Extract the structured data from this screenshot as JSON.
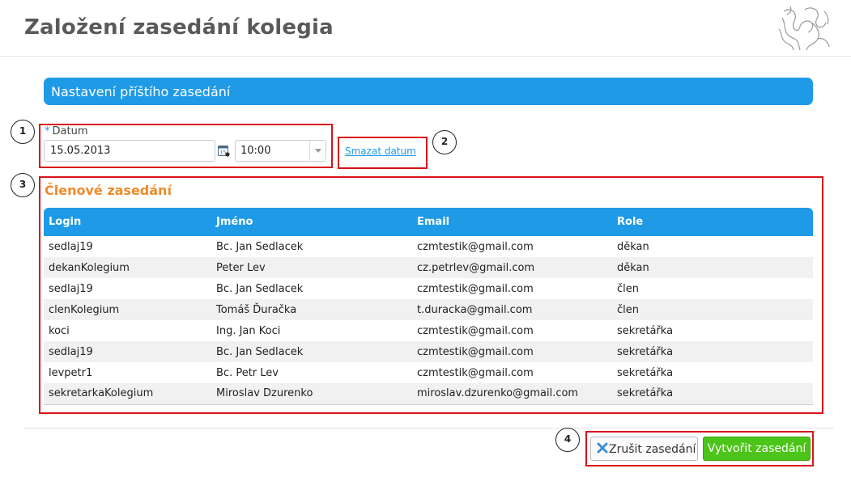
{
  "header": {
    "title": "Založení zasedání kolegia"
  },
  "section": {
    "title": "Nastavení příštího zasedání"
  },
  "date_form": {
    "required_mark": "*",
    "label": "Datum",
    "date_value": "15.05.2013",
    "time_value": "10:00",
    "clear_link": "Smazat datum"
  },
  "members": {
    "title": "Členové zasedání",
    "columns": [
      "Login",
      "Jméno",
      "Email",
      "Role"
    ],
    "rows": [
      [
        "sedlaj19",
        "Bc. Jan Sedlacek",
        "czmtestik@gmail.com",
        "děkan"
      ],
      [
        "dekanKolegium",
        "Peter Lev",
        "cz.petrlev@gmail.com",
        "děkan"
      ],
      [
        "sedlaj19",
        "Bc. Jan Sedlacek",
        "czmtestik@gmail.com",
        "člen"
      ],
      [
        "clenKolegium",
        "Tomáš Ďuračka",
        "t.duracka@gmail.com",
        "člen"
      ],
      [
        "koci",
        "Ing. Jan Koci",
        "czmtestik@gmail.com",
        "sekretářka"
      ],
      [
        "sedlaj19",
        "Bc. Jan Sedlacek",
        "czmtestik@gmail.com",
        "sekretářka"
      ],
      [
        "levpetr1",
        "Bc. Petr Lev",
        "czmtestik@gmail.com",
        "sekretářka"
      ],
      [
        "sekretarkaKolegium",
        "Miroslav Dzurenko",
        "miroslav.dzurenko@gmail.com",
        "sekretářka"
      ]
    ]
  },
  "actions": {
    "cancel_label": "Zrušit zasedání",
    "create_label": "Vytvořit zasedání"
  },
  "callouts": [
    "1",
    "2",
    "3",
    "4"
  ],
  "icons": {
    "logo": "lion-logo-icon",
    "calendar": "calendar-icon",
    "dropdown": "chevron-down-icon",
    "cancel": "close-icon"
  },
  "colors": {
    "accent": "#1e9ae6",
    "members_title": "#ef8a2a",
    "create_button": "#4cc419",
    "annotation": "#d9131a"
  }
}
